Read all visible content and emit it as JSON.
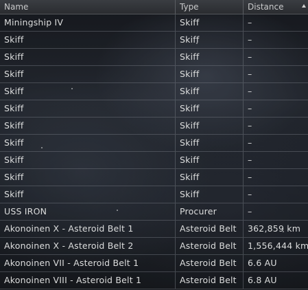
{
  "table": {
    "columns": {
      "name": "Name",
      "type": "Type",
      "distance": "Distance"
    },
    "rows": [
      {
        "name": "Miningship IV",
        "type": "Skiff",
        "distance": "–"
      },
      {
        "name": "Skiff",
        "type": "Skiff",
        "distance": "–"
      },
      {
        "name": "Skiff",
        "type": "Skiff",
        "distance": "–"
      },
      {
        "name": "Skiff",
        "type": "Skiff",
        "distance": "–"
      },
      {
        "name": "Skiff",
        "type": "Skiff",
        "distance": "–"
      },
      {
        "name": "Skiff",
        "type": "Skiff",
        "distance": "–"
      },
      {
        "name": "Skiff",
        "type": "Skiff",
        "distance": "–"
      },
      {
        "name": "Skiff",
        "type": "Skiff",
        "distance": "–"
      },
      {
        "name": "Skiff",
        "type": "Skiff",
        "distance": "–"
      },
      {
        "name": "Skiff",
        "type": "Skiff",
        "distance": "–"
      },
      {
        "name": "Skiff",
        "type": "Skiff",
        "distance": "–"
      },
      {
        "name": "USS IRON",
        "type": "Procurer",
        "distance": "–"
      },
      {
        "name": "Akonoinen X - Asteroid Belt 1",
        "type": "Asteroid Belt",
        "distance": "362,859 km"
      },
      {
        "name": "Akonoinen X - Asteroid Belt 2",
        "type": "Asteroid Belt",
        "distance": "1,556,444 km"
      },
      {
        "name": "Akonoinen VII - Asteroid Belt 1",
        "type": "Asteroid Belt",
        "distance": "6.6 AU"
      },
      {
        "name": "Akonoinen VIII - Asteroid Belt 1",
        "type": "Asteroid Belt",
        "distance": "6.8 AU"
      }
    ]
  }
}
